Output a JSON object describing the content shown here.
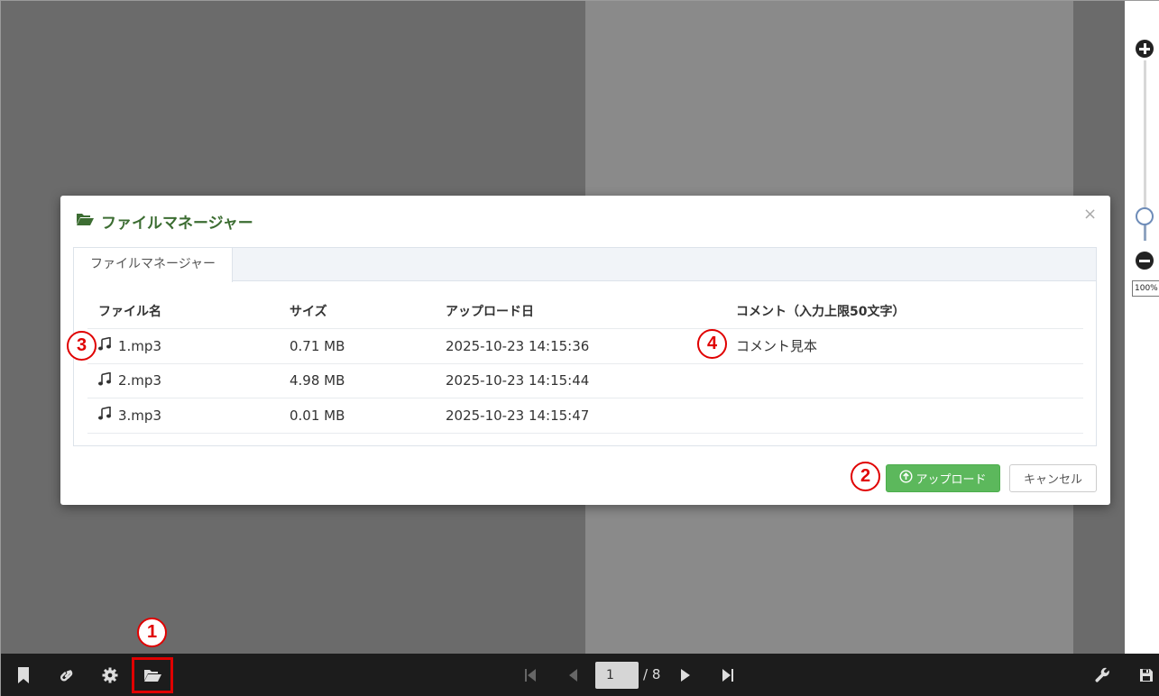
{
  "modal": {
    "title": "ファイルマネージャー",
    "tab_label": "ファイルマネージャー",
    "columns": [
      "ファイル名",
      "サイズ",
      "アップロード日",
      "コメント（入力上限50文字）"
    ],
    "rows": [
      {
        "name": "1.mp3",
        "size": "0.71 MB",
        "date": "2025-10-23 14:15:36",
        "comment": "コメント見本"
      },
      {
        "name": "2.mp3",
        "size": "4.98 MB",
        "date": "2025-10-23 14:15:44",
        "comment": ""
      },
      {
        "name": "3.mp3",
        "size": "0.01 MB",
        "date": "2025-10-23 14:15:47",
        "comment": ""
      }
    ],
    "upload_label": "アップロード",
    "cancel_label": "キャンセル",
    "close_symbol": "×"
  },
  "zoom": {
    "level": "100%"
  },
  "pager": {
    "current": "1",
    "total": "/ 8"
  },
  "annotations": {
    "n1": "1",
    "n2": "2",
    "n3": "3",
    "n4": "4"
  },
  "colors": {
    "accent_green": "#5cb85c",
    "title_green": "#3c6d32",
    "annotation_red": "#e00000",
    "toolbar_bg": "#1c1c1c"
  },
  "icons": [
    "bookmark-icon",
    "link-icon",
    "gear-icon",
    "folder-open-icon",
    "first-page-icon",
    "prev-page-icon",
    "next-page-icon",
    "last-page-icon",
    "wrench-icon",
    "save-icon",
    "music-note-icon",
    "upload-circle-icon",
    "close-icon",
    "zoom-in-icon",
    "zoom-out-icon"
  ]
}
